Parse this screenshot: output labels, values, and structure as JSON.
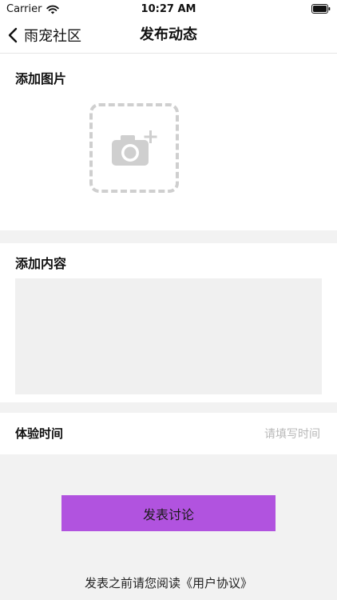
{
  "status_bar": {
    "carrier": "Carrier",
    "time": "10:27 AM",
    "icons": [
      "wifi-icon",
      "battery-icon"
    ]
  },
  "nav": {
    "back_label": "雨宠社区",
    "title": "发布动态",
    "back_icon": "chevron-left-icon"
  },
  "image_section": {
    "title": "添加图片",
    "picker_icon": "camera-plus-icon"
  },
  "content_section": {
    "title": "添加内容",
    "text_value": ""
  },
  "time_row": {
    "label": "体验时间",
    "placeholder": "请填写时间",
    "value": ""
  },
  "submit": {
    "label": "发表讨论",
    "color": "#b153df"
  },
  "agreement": {
    "prefix": "发表之前请您阅读",
    "link": "《用户协议》"
  },
  "colors": {
    "background": "#f2f2f2",
    "card": "#ffffff",
    "accent": "#b153df",
    "placeholder": "#b8b8b8"
  }
}
